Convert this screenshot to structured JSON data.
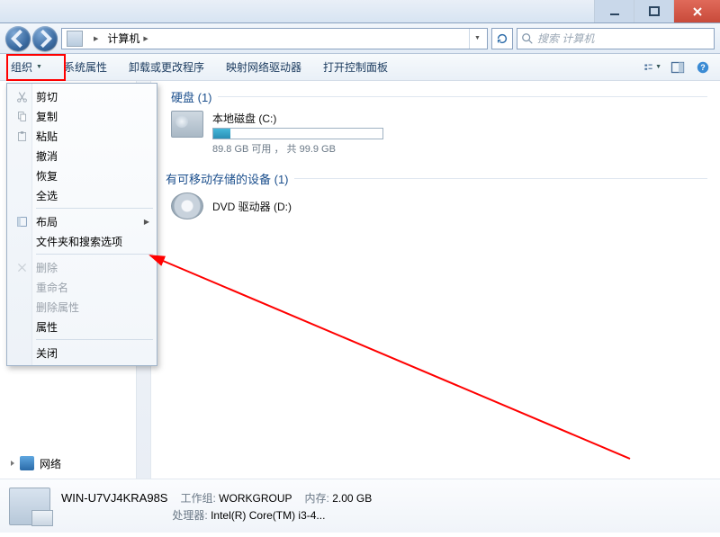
{
  "titlebar": {
    "min": "",
    "max": "",
    "close": ""
  },
  "address": {
    "root_label": "计算机",
    "search_placeholder": "搜索 计算机"
  },
  "toolbar": {
    "organize": "组织",
    "items": [
      "系统属性",
      "卸载或更改程序",
      "映射网络驱动器",
      "打开控制面板"
    ]
  },
  "menu": {
    "cut": "剪切",
    "copy": "复制",
    "paste": "粘贴",
    "undo": "撤消",
    "redo": "恢复",
    "select_all": "全选",
    "layout": "布局",
    "folder_search_options": "文件夹和搜索选项",
    "delete": "删除",
    "rename": "重命名",
    "remove_properties": "删除属性",
    "properties": "属性",
    "close": "关闭"
  },
  "sidebar": {
    "network": "网络"
  },
  "main": {
    "group_hdd": "硬盘 (1)",
    "group_removable": "有可移动存储的设备 (1)",
    "hdd": {
      "name": "本地磁盘 (C:)",
      "free_text": "89.8 GB 可用 ， 共 99.9 GB",
      "fill_pct": 10
    },
    "dvd": {
      "name": "DVD 驱动器 (D:)"
    }
  },
  "details": {
    "hostname": "WIN-U7VJ4KRA98S",
    "workgroup_label": "工作组:",
    "workgroup": "WORKGROUP",
    "mem_label": "内存:",
    "mem": "2.00 GB",
    "cpu_label": "处理器:",
    "cpu": "Intel(R) Core(TM) i3-4..."
  }
}
